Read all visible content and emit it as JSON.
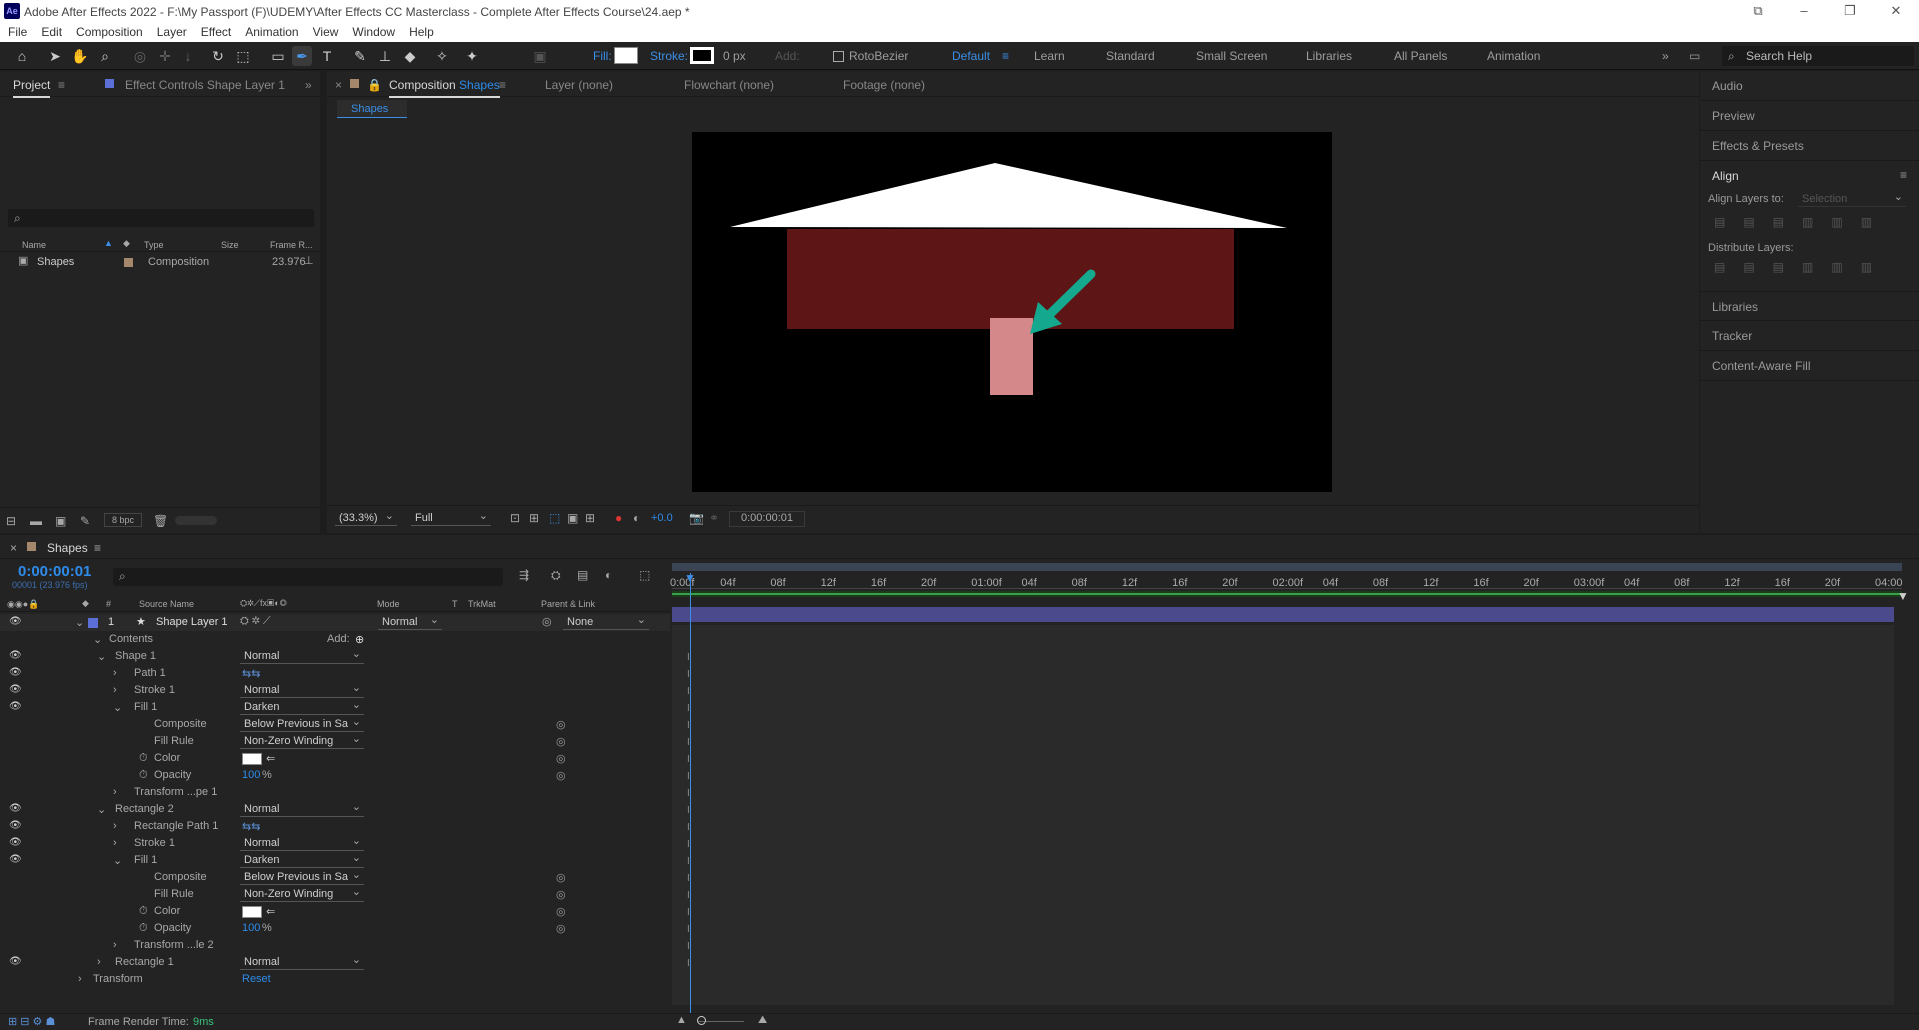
{
  "window": {
    "title": "Adobe After Effects 2022 - F:\\My Passport (F)\\UDEMY\\After Effects CC Masterclass - Complete After Effects Course\\24.aep *",
    "logo": "Ae"
  },
  "menu": [
    "File",
    "Edit",
    "Composition",
    "Layer",
    "Effect",
    "Animation",
    "View",
    "Window",
    "Help"
  ],
  "toolbar": {
    "fill": "Fill:",
    "stroke": "Stroke:",
    "stroke_px": "0 px",
    "add": "Add:",
    "rotobezier": "RotoBezier",
    "workspaces": [
      "Default",
      "Learn",
      "Standard",
      "Small Screen",
      "Libraries",
      "All Panels",
      "Animation"
    ],
    "search": "Search Help"
  },
  "project": {
    "tab": "Project",
    "effect_tab": "Effect Controls Shape Layer 1",
    "columns": [
      "Name",
      "Type",
      "Size",
      "Frame R..."
    ],
    "item": {
      "name": "Shapes",
      "type": "Composition",
      "rate": "23.976"
    },
    "bpc": "8 bpc"
  },
  "comp": {
    "tab_label": "Composition",
    "tab_name": "Shapes",
    "layer_tab": "Layer (none)",
    "flowchart_tab": "Flowchart (none)",
    "footage_tab": "Footage (none)",
    "sub_tab": "Shapes",
    "zoom": "(33.3%)",
    "quality": "Full",
    "exposure": "+0.0",
    "time": "0:00:00:01",
    "colors": {
      "roof": "#ffffff",
      "wall": "#5e1516",
      "door": "#d4888a",
      "arrow": "#14a98f"
    }
  },
  "right": {
    "items": [
      "Audio",
      "Preview",
      "Effects & Presets"
    ],
    "align": "Align",
    "align_to": "Align Layers to:",
    "selection": "Selection",
    "distribute": "Distribute Layers:",
    "lower": [
      "Libraries",
      "Tracker",
      "Content-Aware Fill"
    ]
  },
  "timeline": {
    "tab": "Shapes",
    "timecode": "0:00:00:01",
    "frames": "00001 (23.976 fps)",
    "headers": {
      "source": "Source Name",
      "mode": "Mode",
      "t": "T",
      "trkmat": "TrkMat",
      "parent": "Parent & Link"
    },
    "layer": {
      "num": "1",
      "name": "Shape Layer 1",
      "mode": "Normal",
      "parent": "None"
    },
    "contents": "Contents",
    "add": "Add:",
    "ruler": [
      "0:00f",
      "04f",
      "08f",
      "12f",
      "16f",
      "20f",
      "01:00f",
      "04f",
      "08f",
      "12f",
      "16f",
      "20f",
      "02:00f",
      "04f",
      "08f",
      "12f",
      "16f",
      "20f",
      "03:00f",
      "04f",
      "08f",
      "12f",
      "16f",
      "20f",
      "04:00"
    ],
    "rows": [
      {
        "name": "Shape 1",
        "indent": 1,
        "twirl": "open",
        "eye": true,
        "mode": "Normal"
      },
      {
        "name": "Path 1",
        "indent": 2,
        "twirl": "closed",
        "eye": true,
        "icon": true
      },
      {
        "name": "Stroke 1",
        "indent": 2,
        "twirl": "closed",
        "eye": true,
        "mode": "Normal"
      },
      {
        "name": "Fill 1",
        "indent": 2,
        "twirl": "open",
        "eye": true,
        "mode": "Darken"
      },
      {
        "name": "Composite",
        "indent": 3,
        "value": "Below Previous in Sa",
        "swirl": true
      },
      {
        "name": "Fill Rule",
        "indent": 3,
        "value": "Non-Zero Winding",
        "swirl": true
      },
      {
        "name": "Color",
        "indent": 3,
        "color": true,
        "stopwatch": true,
        "swirl": true
      },
      {
        "name": "Opacity",
        "indent": 3,
        "num": "100",
        "unit": "%",
        "stopwatch": true,
        "swirl": true
      },
      {
        "name": "Transform ...pe 1",
        "indent": 2,
        "twirl": "closed"
      },
      {
        "name": "Rectangle 2",
        "indent": 1,
        "twirl": "open",
        "eye": true,
        "mode": "Normal"
      },
      {
        "name": "Rectangle Path 1",
        "indent": 2,
        "twirl": "closed",
        "eye": true,
        "icon": true
      },
      {
        "name": "Stroke 1",
        "indent": 2,
        "twirl": "closed",
        "eye": true,
        "mode": "Normal"
      },
      {
        "name": "Fill 1",
        "indent": 2,
        "twirl": "open",
        "eye": true,
        "mode": "Darken"
      },
      {
        "name": "Composite",
        "indent": 3,
        "value": "Below Previous in Sa",
        "swirl": true
      },
      {
        "name": "Fill Rule",
        "indent": 3,
        "value": "Non-Zero Winding",
        "swirl": true
      },
      {
        "name": "Color",
        "indent": 3,
        "color": true,
        "stopwatch": true,
        "swirl": true
      },
      {
        "name": "Opacity",
        "indent": 3,
        "num": "100",
        "unit": "%",
        "stopwatch": true,
        "swirl": true
      },
      {
        "name": "Transform ...le 2",
        "indent": 2,
        "twirl": "closed"
      },
      {
        "name": "Rectangle 1",
        "indent": 1,
        "twirl": "closed",
        "eye": true,
        "mode": "Normal"
      },
      {
        "name": "Transform",
        "indent": 0,
        "twirl": "closed",
        "reset": "Reset"
      }
    ],
    "status_label": "Frame Render Time:",
    "status_value": "9ms"
  }
}
